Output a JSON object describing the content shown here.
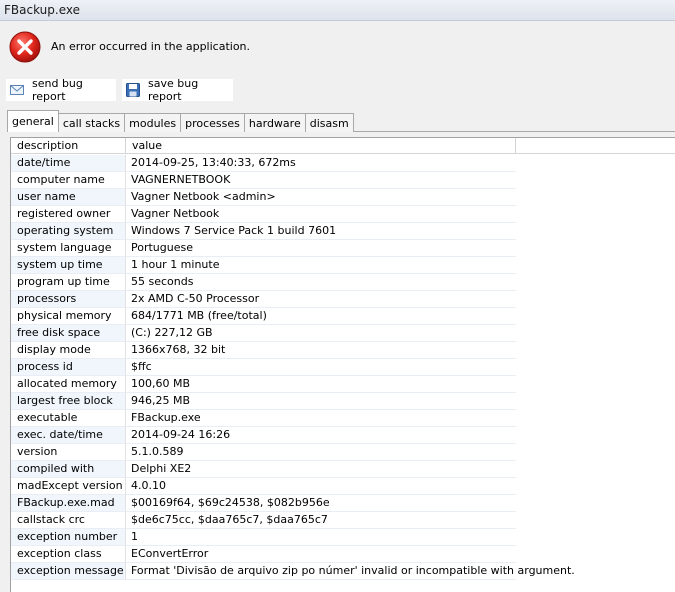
{
  "window": {
    "title": "FBackup.exe"
  },
  "error": {
    "icon": "error-icon",
    "message": "An error occurred in the application."
  },
  "toolbar": {
    "send_label": "send bug report",
    "send_icon": "envelope-icon",
    "save_label": "save bug report",
    "save_icon": "floppy-disk-icon"
  },
  "tabs": [
    {
      "label": "general",
      "active": true
    },
    {
      "label": "call stacks",
      "active": false
    },
    {
      "label": "modules",
      "active": false
    },
    {
      "label": "processes",
      "active": false
    },
    {
      "label": "hardware",
      "active": false
    },
    {
      "label": "disasm",
      "active": false
    }
  ],
  "table": {
    "headers": {
      "description": "description",
      "value": "value"
    },
    "rows": [
      {
        "description": "date/time",
        "value": "2014-09-25, 13:40:33, 672ms"
      },
      {
        "description": "computer name",
        "value": "VAGNERNETBOOK"
      },
      {
        "description": "user name",
        "value": "Vagner Netbook  <admin>"
      },
      {
        "description": "registered owner",
        "value": "Vagner Netbook"
      },
      {
        "description": "operating system",
        "value": "Windows 7 Service Pack 1 build 7601"
      },
      {
        "description": "system language",
        "value": "Portuguese"
      },
      {
        "description": "system up time",
        "value": "1 hour 1 minute"
      },
      {
        "description": "program up time",
        "value": "55 seconds"
      },
      {
        "description": "processors",
        "value": "2x AMD C-50 Processor"
      },
      {
        "description": "physical memory",
        "value": "684/1771 MB (free/total)"
      },
      {
        "description": "free disk space",
        "value": "(C:) 227,12 GB"
      },
      {
        "description": "display mode",
        "value": "1366x768, 32 bit"
      },
      {
        "description": "process id",
        "value": "$ffc"
      },
      {
        "description": "allocated memory",
        "value": "100,60 MB"
      },
      {
        "description": "largest free block",
        "value": "946,25 MB"
      },
      {
        "description": "executable",
        "value": "FBackup.exe"
      },
      {
        "description": "exec. date/time",
        "value": "2014-09-24 16:26"
      },
      {
        "description": "version",
        "value": "5.1.0.589"
      },
      {
        "description": "compiled with",
        "value": "Delphi XE2"
      },
      {
        "description": "madExcept version",
        "value": "4.0.10"
      },
      {
        "description": "FBackup.exe.mad",
        "value": "$00169f64, $69c24538, $082b956e"
      },
      {
        "description": "callstack crc",
        "value": "$de6c75cc, $daa765c7, $daa765c7"
      },
      {
        "description": "exception number",
        "value": "1"
      },
      {
        "description": "exception class",
        "value": "EConvertError"
      },
      {
        "description": "exception message",
        "value": "Format 'Divisão de arquivo zip po númer' invalid or incompatible with argument."
      }
    ]
  }
}
